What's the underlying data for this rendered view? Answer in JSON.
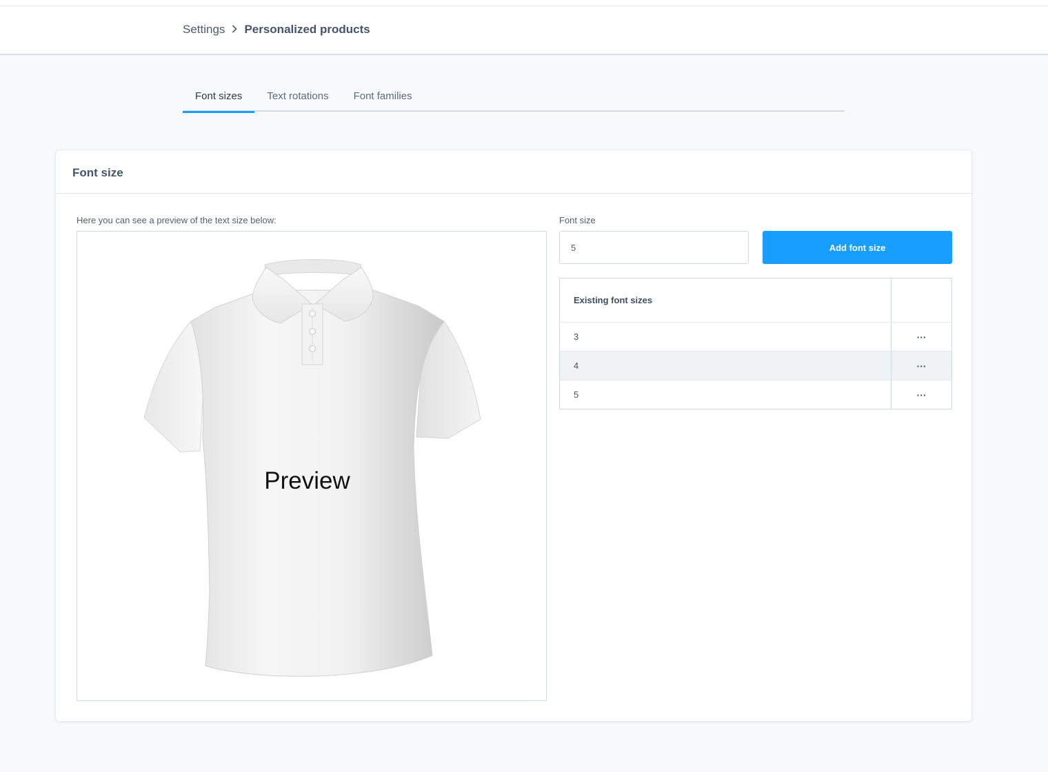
{
  "breadcrumb": {
    "parent": "Settings",
    "current": "Personalized products"
  },
  "tabs": [
    {
      "label": "Font sizes",
      "active": true
    },
    {
      "label": "Text rotations",
      "active": false
    },
    {
      "label": "Font families",
      "active": false
    }
  ],
  "card": {
    "title": "Font size",
    "preview_label": "Here you can see a preview of the text size below:",
    "preview_text": "Preview"
  },
  "form": {
    "label": "Font size",
    "value": "5",
    "button_label": "Add font size"
  },
  "table": {
    "header": "Existing font sizes",
    "rows": [
      {
        "value": "3",
        "action": "···"
      },
      {
        "value": "4",
        "action": "···"
      },
      {
        "value": "5",
        "action": "···"
      }
    ]
  },
  "colors": {
    "accent": "#189eff",
    "background": "#f7f9fa"
  }
}
